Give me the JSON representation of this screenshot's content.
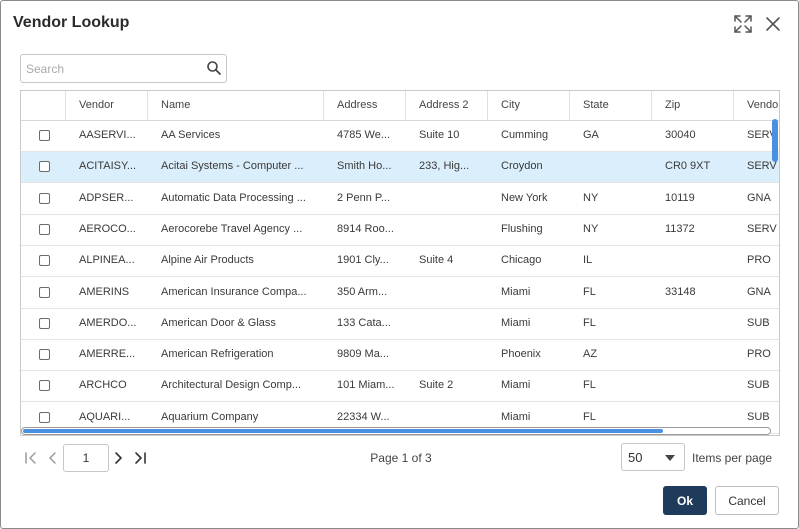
{
  "dialog": {
    "title": "Vendor Lookup"
  },
  "icons": {
    "expand": "expand-icon",
    "close": "close-icon",
    "search": "search-icon"
  },
  "search": {
    "placeholder": "Search",
    "value": ""
  },
  "table": {
    "columns": [
      "",
      "Vendor",
      "Name",
      "Address",
      "Address 2",
      "City",
      "State",
      "Zip",
      "Vendor Type"
    ],
    "selected_row_index": 1,
    "rows": [
      {
        "vendor": "AASERVI...",
        "name": "AA Services",
        "address": "4785 We...",
        "address2": "Suite 10",
        "city": "Cumming",
        "state": "GA",
        "zip": "30040",
        "type": "SERV"
      },
      {
        "vendor": "ACITAISY...",
        "name": "Acitai Systems - Computer ...",
        "address": "Smith Ho...",
        "address2": "233, Hig...",
        "city": "Croydon",
        "state": "",
        "zip": "CR0 9XT",
        "type": "SERV"
      },
      {
        "vendor": "ADPSER...",
        "name": "Automatic Data Processing ...",
        "address": "2 Penn P...",
        "address2": "",
        "city": "New York",
        "state": "NY",
        "zip": "10119",
        "type": "GNA"
      },
      {
        "vendor": "AEROCO...",
        "name": "Aerocorebe Travel Agency ...",
        "address": "8914 Roo...",
        "address2": "",
        "city": "Flushing",
        "state": "NY",
        "zip": "11372",
        "type": "SERV"
      },
      {
        "vendor": "ALPINEA...",
        "name": "Alpine Air Products",
        "address": "1901 Cly...",
        "address2": "Suite 4",
        "city": "Chicago",
        "state": "IL",
        "zip": "",
        "type": "PRO"
      },
      {
        "vendor": "AMERINS",
        "name": "American Insurance Compa...",
        "address": "350 Arm...",
        "address2": "",
        "city": "Miami",
        "state": "FL",
        "zip": "33148",
        "type": "GNA"
      },
      {
        "vendor": "AMERDO...",
        "name": "American Door & Glass",
        "address": "133 Cata...",
        "address2": "",
        "city": "Miami",
        "state": "FL",
        "zip": "",
        "type": "SUB"
      },
      {
        "vendor": "AMERRE...",
        "name": "American Refrigeration",
        "address": "9809 Ma...",
        "address2": "",
        "city": "Phoenix",
        "state": "AZ",
        "zip": "",
        "type": "PRO"
      },
      {
        "vendor": "ARCHCO",
        "name": "Architectural Design Comp...",
        "address": "101 Miam...",
        "address2": "Suite 2",
        "city": "Miami",
        "state": "FL",
        "zip": "",
        "type": "SUB"
      },
      {
        "vendor": "AQUARI...",
        "name": "Aquarium Company",
        "address": "22334 W...",
        "address2": "",
        "city": "Miami",
        "state": "FL",
        "zip": "",
        "type": "SUB"
      }
    ]
  },
  "pagination": {
    "current_page": "1",
    "page_info": "Page 1 of 3",
    "items_per_page": "50",
    "items_per_page_label": "Items per page"
  },
  "buttons": {
    "ok": "Ok",
    "cancel": "Cancel"
  },
  "colors": {
    "primary": "#1f3b5c",
    "selected_row": "#dbeefb",
    "scrollbar": "#4a90e2"
  }
}
